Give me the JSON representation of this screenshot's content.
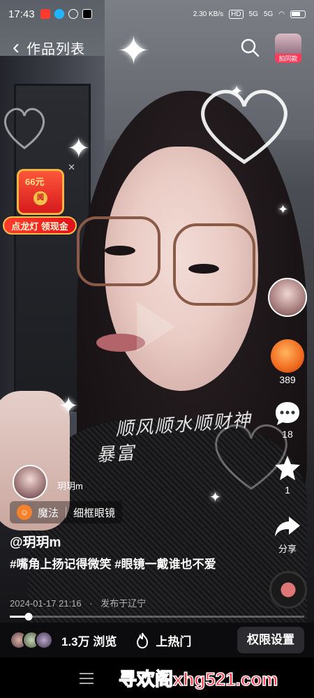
{
  "status_bar": {
    "time": "17:43",
    "speed": "2.30 KB/s",
    "signal1": "5G",
    "signal2": "5G"
  },
  "header": {
    "title": "作品列表",
    "same_style_label": "拍同款"
  },
  "promo": {
    "amount": "66元",
    "coin": "阅",
    "button": "点龙灯 领现金"
  },
  "video": {
    "overlay_line1": "顺风顺水顺财神",
    "overlay_line2": "暴富"
  },
  "actions": {
    "likes": "389",
    "comments": "18",
    "favorites": "1",
    "share": "分享"
  },
  "author": {
    "name": "玥玥m",
    "handle": "@玥玥m"
  },
  "magic": {
    "label": "魔法",
    "effect": "细框眼镜"
  },
  "caption": {
    "tag1": "#嘴角上扬记得微笑",
    "tag2": "#眼镜一戴谁也不爱"
  },
  "meta": {
    "date": "2024-01-17 21:16",
    "separator": "·",
    "location": "发布于辽宁"
  },
  "progress": {
    "fraction": 0.065
  },
  "bottom_bar": {
    "views": "1.3万 浏览",
    "hot": "上热门",
    "permission": "权限设置"
  },
  "watermark": "寻欢阁xhg521.com",
  "colors": {
    "accent": "#ff2a3a",
    "frame": "#8a5a48",
    "promo": "#e0121a"
  }
}
